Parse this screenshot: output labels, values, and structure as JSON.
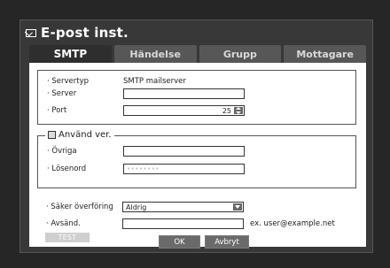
{
  "dialog": {
    "title": "E-post inst.",
    "title_icon": "envelope-icon"
  },
  "tabs": [
    {
      "label": "SMTP",
      "active": true
    },
    {
      "label": "Händelse",
      "active": false
    },
    {
      "label": "Grupp",
      "active": false
    },
    {
      "label": "Mottagare",
      "active": false
    }
  ],
  "smtp": {
    "server_type_label": "· Servertyp",
    "server_type_value": "SMTP mailserver",
    "server_label": "· Server",
    "server_value": "",
    "port_label": "· Port",
    "port_value": "25"
  },
  "auth": {
    "use_label": "Använd ver.",
    "checked": false,
    "user_label": "· Övriga",
    "user_value": "",
    "password_label": "· Lösenord",
    "password_value": "••••••••"
  },
  "security": {
    "secure_label": "· Säker överföring",
    "secure_value": "Aldrig",
    "sender_label": "· Avsänd.",
    "sender_value": "",
    "sender_hint": "ex. user@example.net",
    "test_label": "TEST"
  },
  "footer": {
    "ok_label": "OK",
    "cancel_label": "Avbryt"
  }
}
